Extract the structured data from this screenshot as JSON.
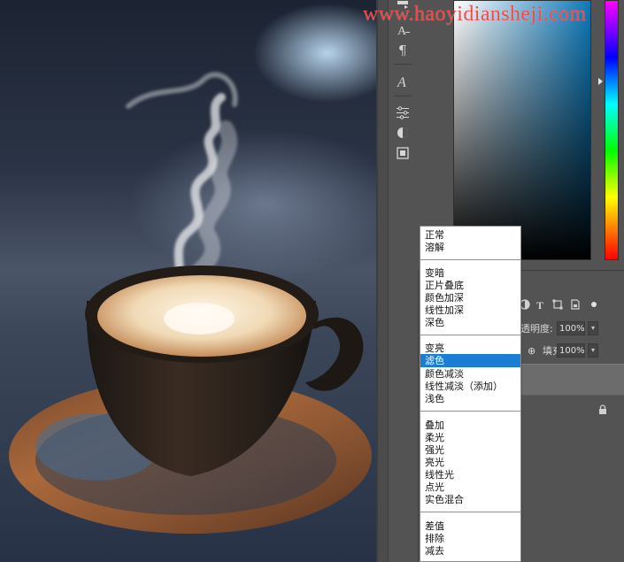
{
  "watermark": {
    "text": "www.haoyidiansheji.com"
  },
  "tool_strip": {
    "icons": [
      "character-panel-icon",
      "type-tool-icon",
      "paragraph-icon",
      "glyphs-icon",
      "adjustments-icon",
      "styles-icon",
      "history-icon"
    ]
  },
  "color_picker": {
    "field_hue_color": "#0f79b9",
    "slider": "spectrum"
  },
  "layers": {
    "opacity_label": "透明度:",
    "opacity_value": "100%",
    "fill_label": "填充:",
    "fill_value": "100%"
  },
  "blend_menu": {
    "groups": [
      [
        "正常",
        "溶解"
      ],
      [
        "变暗",
        "正片叠底",
        "颜色加深",
        "线性加深",
        "深色"
      ],
      [
        "变亮",
        "滤色",
        "颜色减淡",
        "线性减淡（添加）",
        "浅色"
      ],
      [
        "叠加",
        "柔光",
        "强光",
        "亮光",
        "线性光",
        "点光",
        "实色混合"
      ],
      [
        "差值",
        "排除",
        "减去"
      ]
    ],
    "selected": "滤色",
    "selected_color": "#1a7fd4"
  }
}
